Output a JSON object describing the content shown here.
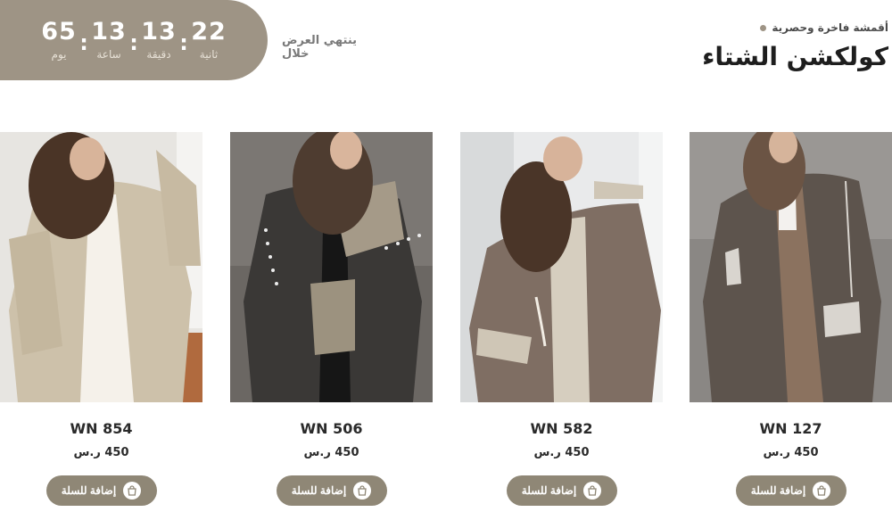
{
  "countdown": {
    "units": [
      {
        "value": "65",
        "label": "يوم"
      },
      {
        "value": "13",
        "label": "ساعة"
      },
      {
        "value": "13",
        "label": "دقيقة"
      },
      {
        "value": "22",
        "label": "ثانية"
      }
    ],
    "ends_label": "ينتهي العرض خلال"
  },
  "section": {
    "subtitle": "أقمشة فاخرة وحصرية",
    "title": "كولكشن الشتاء"
  },
  "cart_label": "إضافة للسلة",
  "products": [
    {
      "name": "WN 854",
      "price": "450 ر.س",
      "tone": "#cfc3ad",
      "background": "#e6e4e0"
    },
    {
      "name": "WN 506",
      "price": "450 ر.س",
      "tone": "#3a3836",
      "background": "#7a7672"
    },
    {
      "name": "WN 582",
      "price": "450 ر.س",
      "tone": "#7e6d62",
      "background": "#e8e9ea"
    },
    {
      "name": "WN 127",
      "price": "450 ر.س",
      "tone": "#5e554e",
      "background": "#8a8784"
    }
  ],
  "colors": {
    "accent": "#9e9485",
    "button": "#8f8776"
  }
}
